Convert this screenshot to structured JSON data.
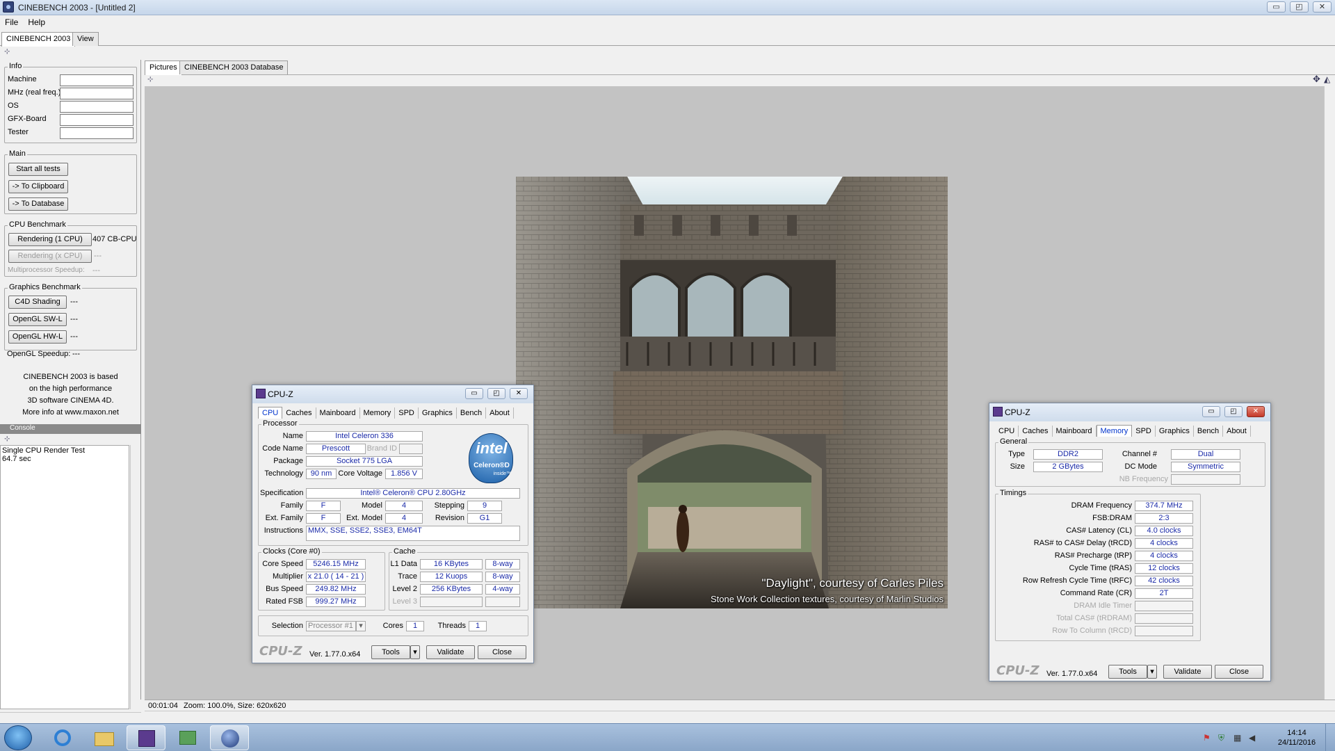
{
  "window": {
    "title": "CINEBENCH 2003 - [Untitled 2]",
    "min": "▭",
    "max": "◰",
    "close": "✕"
  },
  "menu": [
    "File",
    "Help"
  ],
  "top_tabs": [
    "CINEBENCH 2003",
    "View"
  ],
  "view_tabs": [
    "Pictures",
    "CINEBENCH 2003 Database"
  ],
  "info": {
    "title": "Info",
    "fields": [
      "Machine",
      "MHz (real freq.)",
      "OS",
      "GFX-Board",
      "Tester"
    ]
  },
  "main": {
    "title": "Main",
    "start": "Start all tests",
    "clipboard": "-> To Clipboard",
    "database": "-> To Database"
  },
  "cpu_bench": {
    "title": "CPU Benchmark",
    "render1": "Rendering (1 CPU)",
    "render1_result": "407 CB-CPU",
    "renderx": "Rendering (x CPU)",
    "renderx_result": "---",
    "mp": "Multiprocessor Speedup:",
    "mp_result": "---"
  },
  "gfx_bench": {
    "title": "Graphics Benchmark",
    "c4d": "C4D Shading",
    "c4d_r": "---",
    "sw": "OpenGL SW-L",
    "sw_r": "---",
    "hw": "OpenGL HW-L",
    "hw_r": "---",
    "speedup": "OpenGL Speedup:",
    "speedup_r": "---"
  },
  "about": [
    "CINEBENCH 2003 is based",
    "on the high performance",
    "3D software CINEMA 4D.",
    "More info at www.maxon.net"
  ],
  "console": {
    "title": "Console",
    "lines": [
      "Single CPU Render Test",
      "64.7 sec"
    ]
  },
  "picture": {
    "caption1": "\"Daylight\", courtesy of Carles Piles",
    "caption2": "Stone Work Collection textures, courtesy of Marlin Studios"
  },
  "status": {
    "time": "00:01:04",
    "info": "Zoom: 100.0%, Size: 620x620"
  },
  "clock": {
    "time": "14:14",
    "date": "24/11/2016"
  },
  "cpuz1": {
    "title": "CPU-Z",
    "tabs": [
      "CPU",
      "Caches",
      "Mainboard",
      "Memory",
      "SPD",
      "Graphics",
      "Bench",
      "About"
    ],
    "processor": "Processor",
    "name_l": "Name",
    "name": "Intel Celeron 336",
    "code_l": "Code Name",
    "code": "Prescott",
    "brand_l": "Brand ID",
    "pkg_l": "Package",
    "pkg": "Socket 775 LGA",
    "tech_l": "Technology",
    "tech": "90 nm",
    "cv_l": "Core Voltage",
    "cv": "1.856 V",
    "spec_l": "Specification",
    "spec": "Intel® Celeron® CPU 2.80GHz",
    "fam_l": "Family",
    "fam": "F",
    "model_l": "Model",
    "model": "4",
    "step_l": "Stepping",
    "step": "9",
    "efam_l": "Ext. Family",
    "efam": "F",
    "emodel_l": "Ext. Model",
    "emodel": "4",
    "rev_l": "Revision",
    "rev": "G1",
    "instr_l": "Instructions",
    "instr": "MMX, SSE, SSE2, SSE3, EM64T",
    "logo_brand": "intel",
    "logo_product": "Celeron®D",
    "logo_inside": "inside™",
    "clocks": "Clocks (Core #0)",
    "cs_l": "Core Speed",
    "cs": "5246.15 MHz",
    "mul_l": "Multiplier",
    "mul": "x 21.0 ( 14 - 21 )",
    "bus_l": "Bus Speed",
    "bus": "249.82 MHz",
    "fsb_l": "Rated FSB",
    "fsb": "999.27 MHz",
    "cache": "Cache",
    "l1_l": "L1 Data",
    "l1": "16 KBytes",
    "l1w": "8-way",
    "tr_l": "Trace",
    "tr": "12 Kuops",
    "trw": "8-way",
    "l2_l": "Level 2",
    "l2": "256 KBytes",
    "l2w": "4-way",
    "l3_l": "Level 3",
    "sel_l": "Selection",
    "sel": "Processor #1",
    "cores_l": "Cores",
    "cores": "1",
    "thr_l": "Threads",
    "thr": "1",
    "logo": "CPU-Z",
    "ver": "Ver. 1.77.0.x64",
    "tools": "Tools",
    "validate": "Validate",
    "close": "Close"
  },
  "cpuz2": {
    "title": "CPU-Z",
    "tabs": [
      "CPU",
      "Caches",
      "Mainboard",
      "Memory",
      "SPD",
      "Graphics",
      "Bench",
      "About"
    ],
    "general": "General",
    "type_l": "Type",
    "type": "DDR2",
    "ch_l": "Channel #",
    "ch": "Dual",
    "size_l": "Size",
    "size": "2 GBytes",
    "dc_l": "DC Mode",
    "dc": "Symmetric",
    "nb_l": "NB Frequency",
    "timings": "Timings",
    "rows": [
      {
        "l": "DRAM Frequency",
        "v": "374.7 MHz"
      },
      {
        "l": "FSB:DRAM",
        "v": "2:3"
      },
      {
        "l": "CAS# Latency (CL)",
        "v": "4.0 clocks"
      },
      {
        "l": "RAS# to CAS# Delay (tRCD)",
        "v": "4 clocks"
      },
      {
        "l": "RAS# Precharge (tRP)",
        "v": "4 clocks"
      },
      {
        "l": "Cycle Time (tRAS)",
        "v": "12 clocks"
      },
      {
        "l": "Row Refresh Cycle Time (tRFC)",
        "v": "42 clocks"
      },
      {
        "l": "Command Rate (CR)",
        "v": "2T"
      },
      {
        "l": "DRAM Idle Timer",
        "v": ""
      },
      {
        "l": "Total CAS# (tRDRAM)",
        "v": ""
      },
      {
        "l": "Row To Column (tRCD)",
        "v": ""
      }
    ],
    "logo": "CPU-Z",
    "ver": "Ver. 1.77.0.x64",
    "tools": "Tools",
    "validate": "Validate",
    "close": "Close"
  }
}
